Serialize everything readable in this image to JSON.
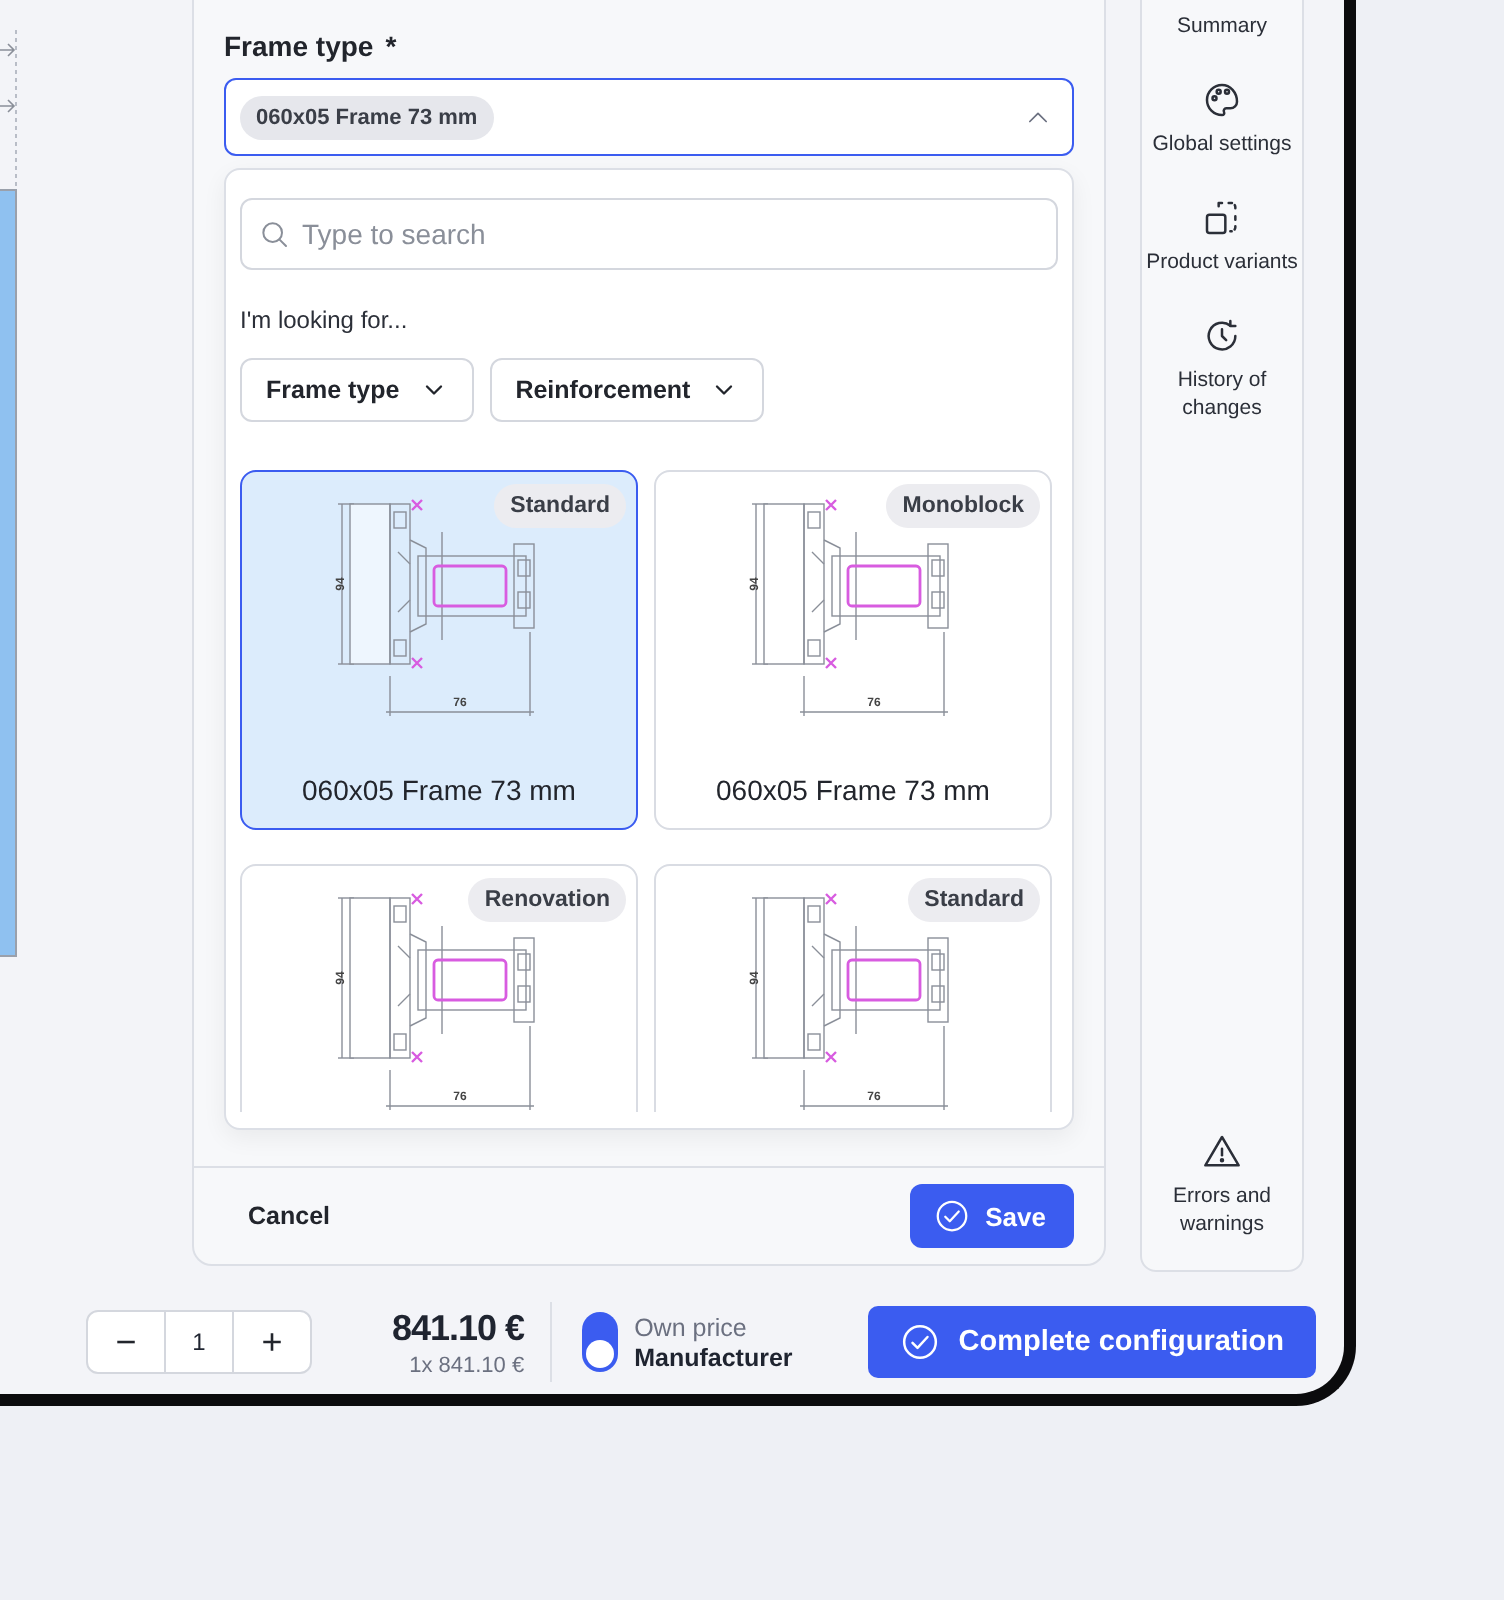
{
  "field": {
    "label": "Frame type",
    "required_mark": "*",
    "value": "060x05 Frame 73 mm",
    "expanded": true
  },
  "dropdown": {
    "search_placeholder": "Type to search",
    "prompt": "I'm looking for...",
    "filters": [
      {
        "label": "Frame type"
      },
      {
        "label": "Reinforcement"
      }
    ],
    "options": [
      {
        "tag": "Standard",
        "name": "060x05 Frame 73 mm",
        "height_label": "94",
        "width_label": "76",
        "selected": true
      },
      {
        "tag": "Monoblock",
        "name": "060x05 Frame 73 mm",
        "height_label": "94",
        "width_label": "76",
        "selected": false
      },
      {
        "tag": "Renovation",
        "height_label": "94",
        "width_label": "76",
        "selected": false
      },
      {
        "tag": "Standard",
        "height_label": "94",
        "width_label": "76",
        "selected": false
      }
    ]
  },
  "footer": {
    "cancel": "Cancel",
    "save": "Save"
  },
  "sidebar": {
    "items": [
      {
        "label": "Summary"
      },
      {
        "label": "Global settings"
      },
      {
        "label": "Product variants"
      },
      {
        "label": "History of changes"
      },
      {
        "label": "Errors and warnings"
      }
    ]
  },
  "bottom_bar": {
    "decrement": "−",
    "quantity": "1",
    "increment": "+",
    "price": "841.10 €",
    "unit_price": "1x 841.10 €",
    "price_toggle": {
      "on": true,
      "label": "Own price",
      "value": "Manufacturer"
    },
    "complete": "Complete configuration"
  }
}
